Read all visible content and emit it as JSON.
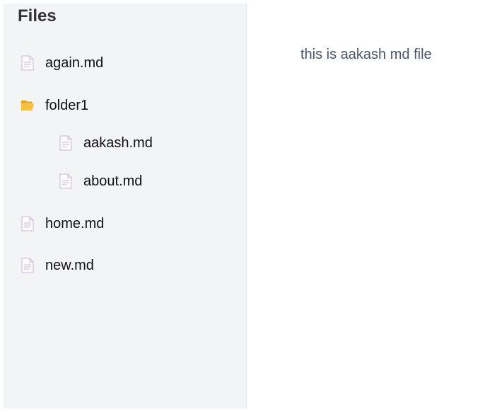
{
  "sidebar": {
    "title": "Files",
    "items": [
      {
        "label": "again.md",
        "icon": "file-icon",
        "type": "file",
        "depth": 0
      },
      {
        "label": "folder1",
        "icon": "folder-open-icon",
        "type": "folder",
        "depth": 0,
        "children": [
          {
            "label": "aakash.md",
            "icon": "file-icon",
            "type": "file",
            "depth": 1
          },
          {
            "label": "about.md",
            "icon": "file-icon",
            "type": "file",
            "depth": 1
          }
        ]
      },
      {
        "label": "home.md",
        "icon": "file-icon",
        "type": "file",
        "depth": 0
      },
      {
        "label": "new.md",
        "icon": "file-icon",
        "type": "file",
        "depth": 0
      }
    ]
  },
  "main": {
    "content": "this is aakash md file"
  },
  "colors": {
    "sidebar_bg": "#f3f4f6",
    "file_icon": "#c9b8d6",
    "folder_icon": "#f5b82e",
    "content_text": "#4b5563"
  }
}
